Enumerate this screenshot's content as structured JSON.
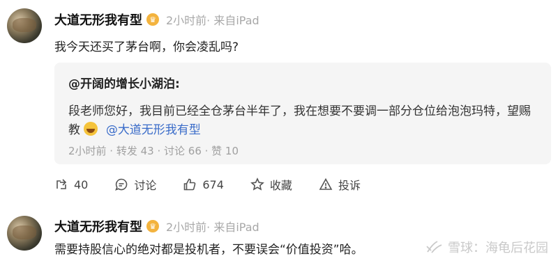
{
  "post1": {
    "username": "大道无形我有型",
    "meta": "2小时前· 来自iPad",
    "text": "我今天还买了茅台啊，你会凌乱吗?",
    "repost": {
      "user": "@开阔的增长小湖泊:",
      "line1": "段老师您好，我目前已经全仓茅台半年了，我在想要不要调一部分仓位给泡泡玛特，望赐",
      "line2_prefix": "教",
      "mention": "@大道无形我有型",
      "stats": "2小时前 · 转发 43 · 讨论 66 · 赞 10"
    },
    "actions": {
      "repost_count": "40",
      "comment_label": "讨论",
      "like_count": "674",
      "favorite_label": "收藏",
      "report_label": "投诉"
    }
  },
  "post2": {
    "username": "大道无形我有型",
    "meta": "2小时前· 来自iPad",
    "text": "需要持股信心的绝对都是投机者，不要误会“价值投资”哈。"
  },
  "watermark": {
    "text": "雪球：海龟后花园"
  },
  "icons": {
    "vip_badge": "crown-badge-icon",
    "repost": "repost-icon",
    "comment": "comment-icon",
    "like": "thumbs-up-icon",
    "favorite": "star-icon",
    "report": "warning-icon",
    "emoji": "laughing-emoji-icon",
    "logo": "snowball-logo-icon"
  },
  "colors": {
    "mention": "#3a6cc9",
    "badge": "#f3b33e",
    "card_bg": "#f5f5f5",
    "meta_gray": "#a8a8a8"
  }
}
